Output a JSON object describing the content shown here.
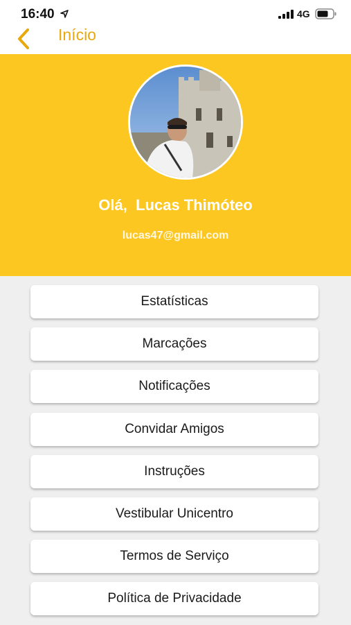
{
  "status_bar": {
    "time": "16:40",
    "network": "4G",
    "icons": [
      "location-arrow-icon",
      "signal-icon",
      "battery-icon"
    ]
  },
  "nav": {
    "back_label": "Início",
    "accent_color": "#E8A90E"
  },
  "profile": {
    "greeting": "Olá,  Lucas Thimóteo",
    "email": "lucas47@gmail.com",
    "header_color": "#FCC721"
  },
  "menu": [
    {
      "label": "Estatísticas"
    },
    {
      "label": "Marcações"
    },
    {
      "label": "Notificações"
    },
    {
      "label": "Convidar Amigos"
    },
    {
      "label": "Instruções"
    },
    {
      "label": "Vestibular Unicentro"
    },
    {
      "label": "Termos de Serviço"
    },
    {
      "label": "Política de Privacidade"
    }
  ]
}
